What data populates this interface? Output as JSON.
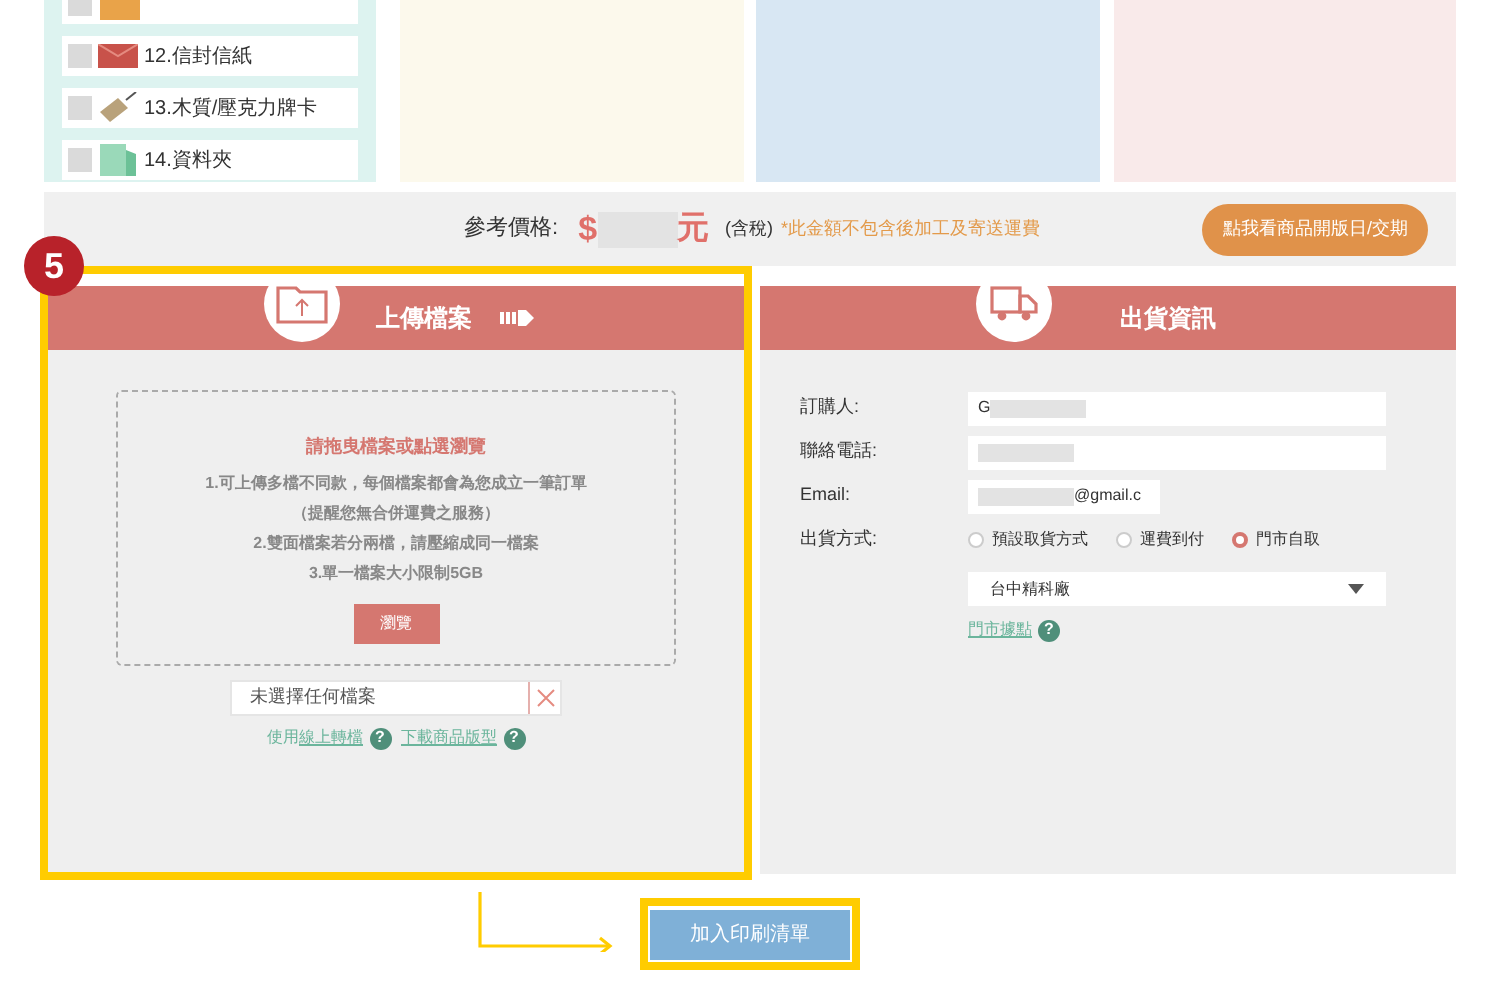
{
  "product_list": [
    {
      "checked": false
    },
    {
      "label": "12.信封信紙",
      "checked": false
    },
    {
      "label": "13.木質/壓克力牌卡",
      "checked": false
    },
    {
      "label": "14.資料夾",
      "checked": false
    }
  ],
  "price_bar": {
    "label": "參考價格:",
    "currency": "$",
    "unit": "元",
    "tax": "(含稅)",
    "note": "*此金額不包含後加工及寄送運費",
    "button": "點我看商品開版日/交期"
  },
  "step_badge": "5",
  "upload": {
    "title": "上傳檔案",
    "drop_title": "請拖曳檔案或點選瀏覽",
    "lines": [
      "1.可上傳多檔不同款，每個檔案都會為您成立一筆訂單",
      "（提醒您無合併運費之服務）",
      "2.雙面檔案若分兩檔，請壓縮成同一檔案",
      "3.單一檔案大小限制5GB"
    ],
    "browse_button": "瀏覽",
    "file_field": "未選擇任何檔案",
    "links": [
      {
        "prefix": "使用",
        "link": "線上轉檔",
        "help": "?"
      },
      {
        "link": "下載商品版型",
        "help": "?"
      }
    ]
  },
  "shipping": {
    "title": "出貨資訊",
    "fields": [
      {
        "label": "訂購人:",
        "value": "G",
        "redacted": true
      },
      {
        "label": "聯絡電話:",
        "redacted": true
      },
      {
        "label": "Email:",
        "value": "@gmail.c",
        "redacted": true
      }
    ],
    "method_label": "出貨方式:",
    "methods": [
      {
        "label": "預設取貨方式",
        "selected": false
      },
      {
        "label": "運費到付",
        "selected": false
      },
      {
        "label": "門市自取",
        "selected": true
      }
    ],
    "store": "台中精科廠",
    "store_link": "門市據點",
    "help": "?"
  },
  "add_button": "加入印刷清單"
}
